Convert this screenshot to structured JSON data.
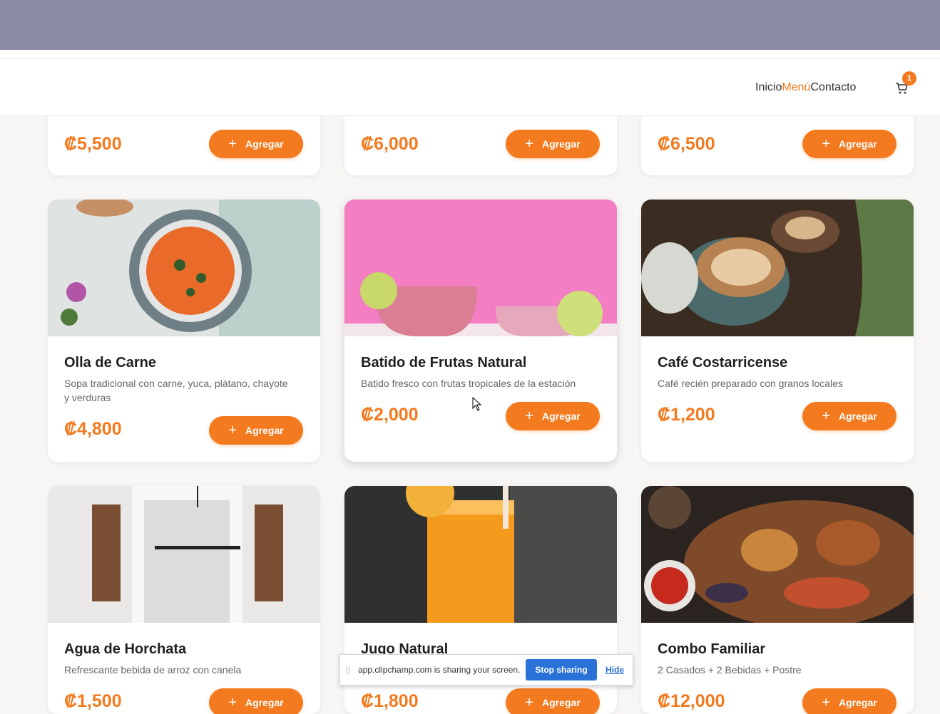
{
  "nav": {
    "links": [
      "Inicio",
      "Menú",
      "Contacto"
    ],
    "active": "Menú",
    "cart_count": "1"
  },
  "row_top": [
    {
      "price": "₡5,500",
      "button": "Agregar"
    },
    {
      "price": "₡6,000",
      "button": "Agregar"
    },
    {
      "price": "₡6,500",
      "button": "Agregar"
    }
  ],
  "row_mid": [
    {
      "title": "Olla de Carne",
      "desc": "Sopa tradicional con carne, yuca, plátano, chayote y verduras",
      "price": "₡4,800",
      "button": "Agregar",
      "image": "soup-image"
    },
    {
      "title": "Batido de Frutas Natural",
      "desc": "Batido fresco con frutas tropicales de la estación",
      "price": "₡2,000",
      "button": "Agregar",
      "image": "smoothie-image"
    },
    {
      "title": "Café Costarricense",
      "desc": "Café recién preparado con granos locales",
      "price": "₡1,200",
      "button": "Agregar",
      "image": "coffee-image"
    }
  ],
  "row_bottom": [
    {
      "title": "Agua de Horchata",
      "desc": "Refrescante bebida de arroz con canela",
      "price": "₡1,500",
      "button": "Agregar",
      "image": "horchata-image"
    },
    {
      "title": "Jugo Natural",
      "desc": "",
      "price": "₡1,800",
      "button": "Agregar",
      "image": "juice-image"
    },
    {
      "title": "Combo Familiar",
      "desc": "2 Casados + 2 Bebidas + Postre",
      "price": "₡12,000",
      "button": "Agregar",
      "image": "grill-image"
    }
  ],
  "share_bar": {
    "message": "app.clipchamp.com is sharing your screen.",
    "stop": "Stop sharing",
    "hide": "Hide"
  },
  "colors": {
    "accent": "#f47a1f",
    "topbar": "#8a8ca6",
    "share_button": "#2a72d8"
  }
}
